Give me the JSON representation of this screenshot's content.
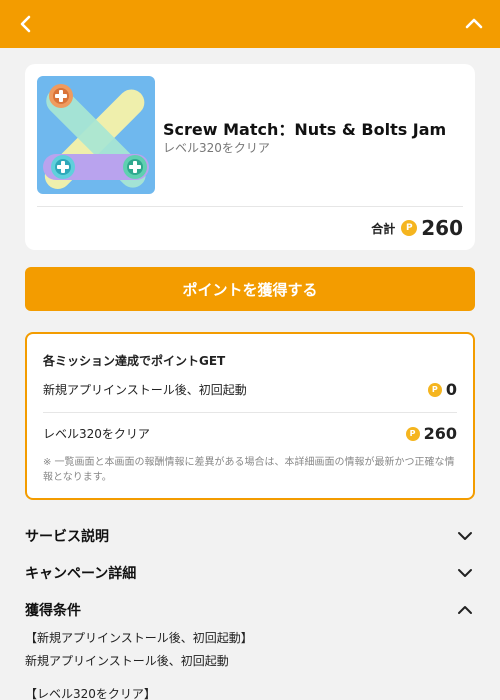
{
  "app": {
    "title": "Screw Match：Nuts & Bolts Jam",
    "subtitle": "レベル320をクリア",
    "total_label": "合計",
    "total_points": "260"
  },
  "cta_label": "ポイントを獲得する",
  "missions": {
    "heading": "各ミッション達成でポイントGET",
    "items": [
      {
        "label": "新規アプリインストール後、初回起動",
        "points": "0"
      },
      {
        "label": "レベル320をクリア",
        "points": "260"
      }
    ],
    "note": "※ 一覧画面と本画面の報酬情報に差異がある場合は、本詳細画面の情報が最新かつ正確な情報となります。"
  },
  "sections": [
    {
      "title": "サービス説明",
      "state": "collapsed"
    },
    {
      "title": "キャンペーン詳細",
      "state": "collapsed"
    },
    {
      "title": "獲得条件",
      "state": "expanded"
    }
  ],
  "conditions": [
    "【新規アプリインストール後、初回起動】",
    "新規アプリインストール後、初回起動",
    "【レベル320をクリア】"
  ],
  "colors": {
    "accent": "#f39c00",
    "coin": "#f5b51f",
    "background": "#f2f2f2"
  },
  "icons": {
    "back": "chevron-left-icon",
    "collapse": "chevron-up-icon",
    "coin": "point-coin-icon"
  }
}
